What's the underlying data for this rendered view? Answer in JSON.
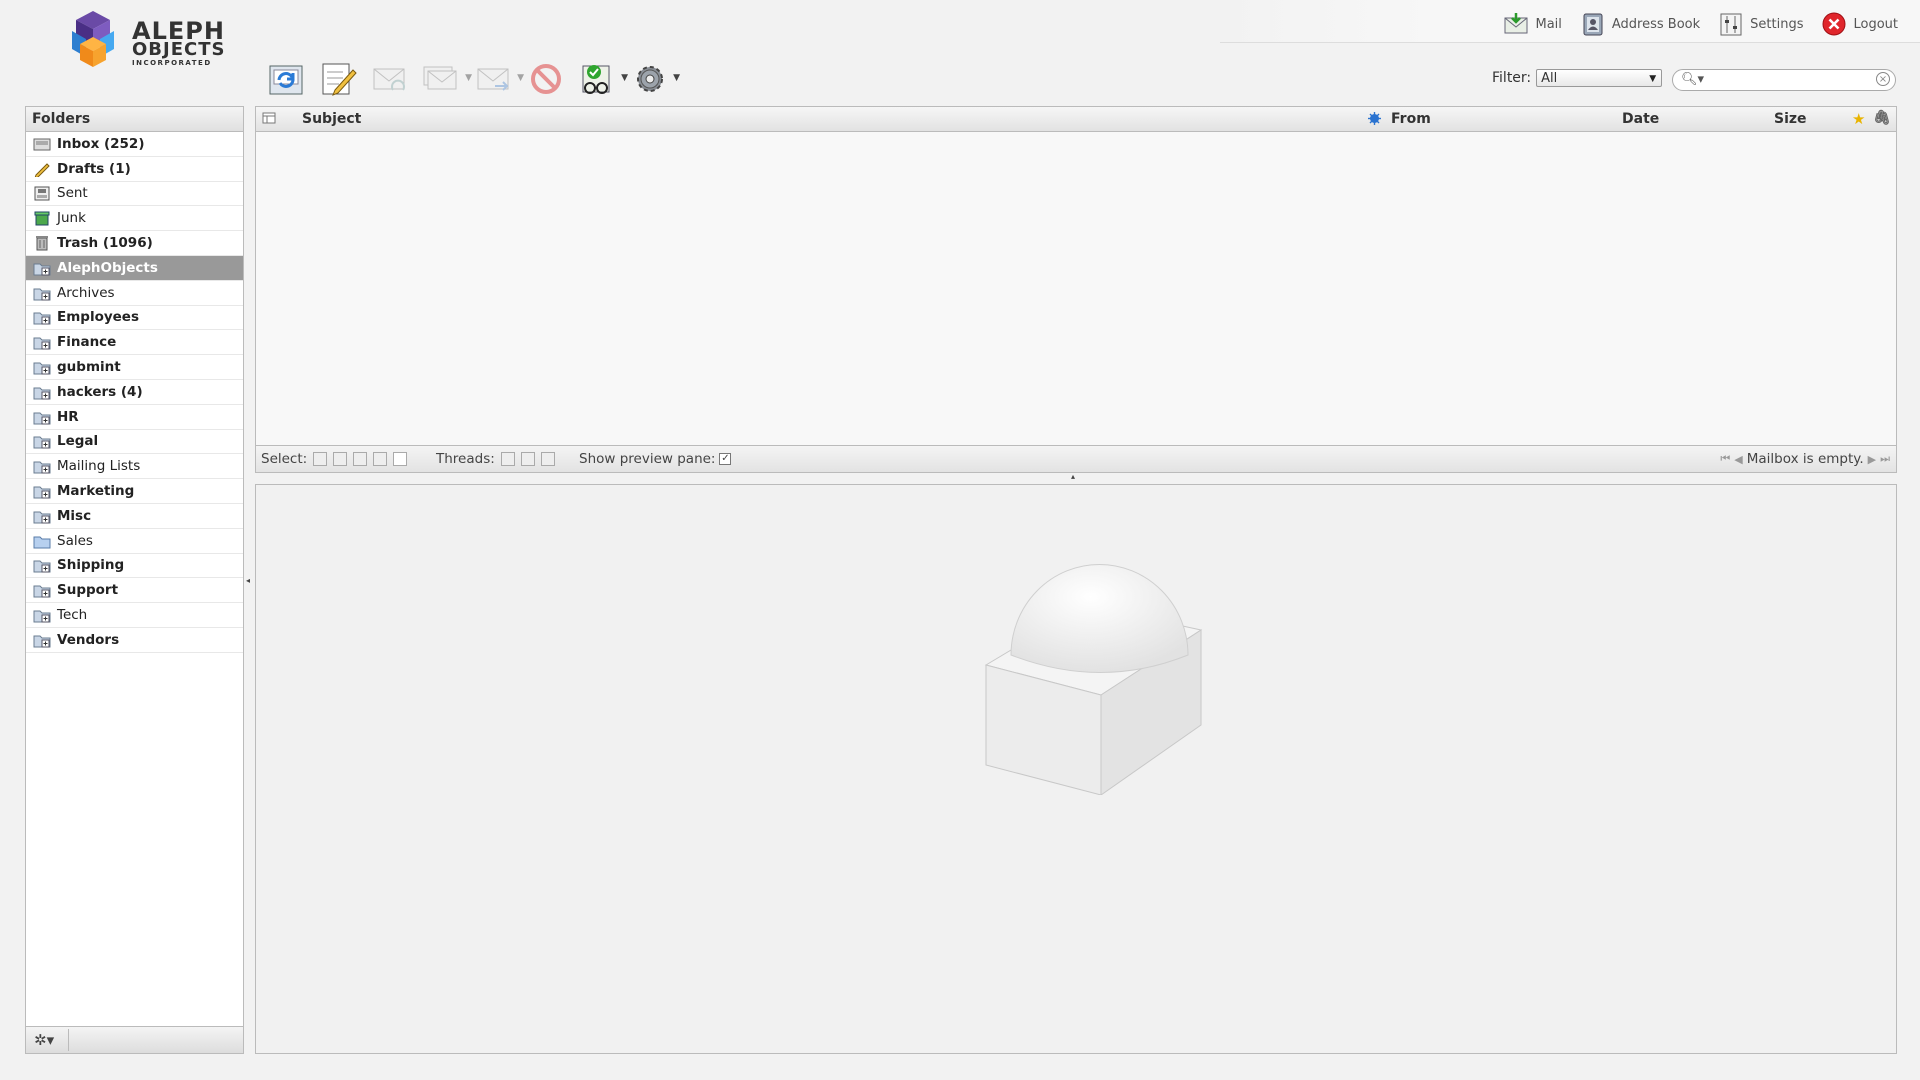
{
  "logo": {
    "line1": "ALEPH",
    "line2": "OBJECTS",
    "line3": "INCORPORATED"
  },
  "topnav": [
    {
      "label": "Mail",
      "icon": "mail-icon"
    },
    {
      "label": "Address Book",
      "icon": "address-book-icon"
    },
    {
      "label": "Settings",
      "icon": "settings-icon"
    },
    {
      "label": "Logout",
      "icon": "logout-icon"
    }
  ],
  "toolbar": [
    {
      "name": "check-mail",
      "icon": "refresh-mail-icon",
      "enabled": true,
      "dropdown": false
    },
    {
      "name": "compose",
      "icon": "compose-icon",
      "enabled": true,
      "dropdown": false
    },
    {
      "name": "reply",
      "icon": "reply-icon",
      "enabled": false,
      "dropdown": false
    },
    {
      "name": "reply-all",
      "icon": "reply-all-icon",
      "enabled": false,
      "dropdown": true
    },
    {
      "name": "forward",
      "icon": "forward-icon",
      "enabled": false,
      "dropdown": true
    },
    {
      "name": "delete",
      "icon": "delete-icon",
      "enabled": false,
      "dropdown": false
    },
    {
      "name": "mark",
      "icon": "mark-icon",
      "enabled": true,
      "dropdown": true
    },
    {
      "name": "more",
      "icon": "gear-icon",
      "enabled": true,
      "dropdown": true
    }
  ],
  "filter": {
    "label": "Filter:",
    "value": "All"
  },
  "search": {
    "placeholder": ""
  },
  "folders": {
    "header": "Folders",
    "items": [
      {
        "label": "Inbox (252)",
        "icon": "inbox-icon",
        "bold": true,
        "selected": false
      },
      {
        "label": "Drafts (1)",
        "icon": "drafts-icon",
        "bold": true,
        "selected": false
      },
      {
        "label": "Sent",
        "icon": "sent-icon",
        "bold": false,
        "selected": false
      },
      {
        "label": "Junk",
        "icon": "junk-icon",
        "bold": false,
        "selected": false
      },
      {
        "label": "Trash (1096)",
        "icon": "trash-icon",
        "bold": true,
        "selected": false
      },
      {
        "label": "AlephObjects",
        "icon": "folder-icon",
        "bold": true,
        "selected": true
      },
      {
        "label": "Archives",
        "icon": "folder-icon",
        "bold": false,
        "selected": false
      },
      {
        "label": "Employees",
        "icon": "folder-icon",
        "bold": true,
        "selected": false
      },
      {
        "label": "Finance",
        "icon": "folder-icon",
        "bold": true,
        "selected": false
      },
      {
        "label": "gubmint",
        "icon": "folder-icon",
        "bold": true,
        "selected": false
      },
      {
        "label": "hackers (4)",
        "icon": "folder-icon",
        "bold": true,
        "selected": false
      },
      {
        "label": "HR",
        "icon": "folder-icon",
        "bold": true,
        "selected": false
      },
      {
        "label": "Legal",
        "icon": "folder-icon",
        "bold": true,
        "selected": false
      },
      {
        "label": "Mailing Lists",
        "icon": "folder-icon",
        "bold": false,
        "selected": false
      },
      {
        "label": "Marketing",
        "icon": "folder-icon",
        "bold": true,
        "selected": false
      },
      {
        "label": "Misc",
        "icon": "folder-icon",
        "bold": true,
        "selected": false
      },
      {
        "label": "Sales",
        "icon": "folder-plain-icon",
        "bold": false,
        "selected": false
      },
      {
        "label": "Shipping",
        "icon": "folder-icon",
        "bold": true,
        "selected": false
      },
      {
        "label": "Support",
        "icon": "folder-icon",
        "bold": true,
        "selected": false
      },
      {
        "label": "Tech",
        "icon": "folder-icon",
        "bold": false,
        "selected": false
      },
      {
        "label": "Vendors",
        "icon": "folder-icon",
        "bold": true,
        "selected": false
      }
    ]
  },
  "messagelist": {
    "columns": {
      "subject": "Subject",
      "from": "From",
      "date": "Date",
      "size": "Size"
    },
    "footer": {
      "select_label": "Select:",
      "threads_label": "Threads:",
      "preview_label": "Show preview pane:",
      "preview_checked": true,
      "status": "Mailbox is empty."
    }
  },
  "colors": {
    "selected_folder_bg": "#999999",
    "logo_orange": "#f7931e",
    "logo_blue": "#3b8fd8",
    "logo_purple": "#5b3a8e"
  }
}
